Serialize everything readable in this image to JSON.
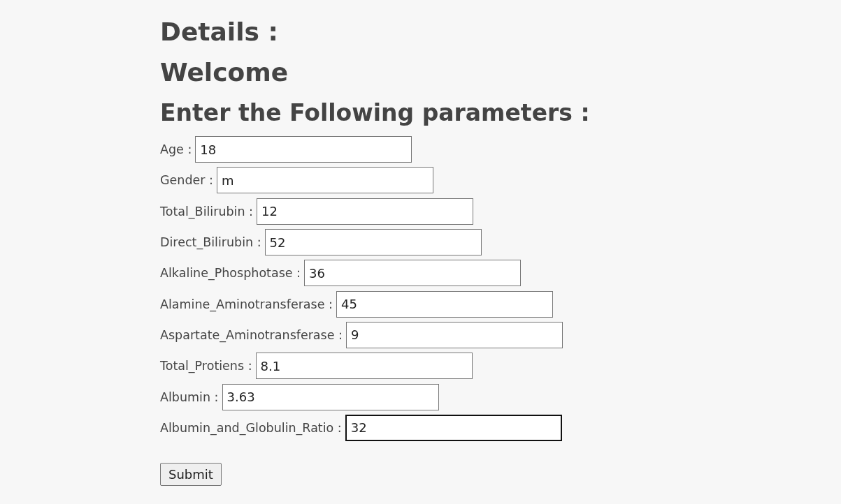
{
  "headings": [
    "Details :",
    "Welcome",
    "Enter the Following parameters :"
  ],
  "fields": [
    {
      "label": "Age :",
      "value": "18",
      "focused": false
    },
    {
      "label": "Gender :",
      "value": "m",
      "focused": false
    },
    {
      "label": "Total_Bilirubin :",
      "value": "12",
      "focused": false
    },
    {
      "label": "Direct_Bilirubin :",
      "value": "52",
      "focused": false
    },
    {
      "label": "Alkaline_Phosphotase :",
      "value": "36",
      "focused": false
    },
    {
      "label": "Alamine_Aminotransferase :",
      "value": "45",
      "focused": false
    },
    {
      "label": "Aspartate_Aminotransferase :",
      "value": "9",
      "focused": false
    },
    {
      "label": "Total_Protiens :",
      "value": "8.1",
      "focused": false
    },
    {
      "label": "Albumin :",
      "value": "3.63",
      "focused": false
    },
    {
      "label": "Albumin_and_Globulin_Ratio :",
      "value": "32",
      "focused": true
    }
  ],
  "submit": {
    "label": "Submit"
  }
}
